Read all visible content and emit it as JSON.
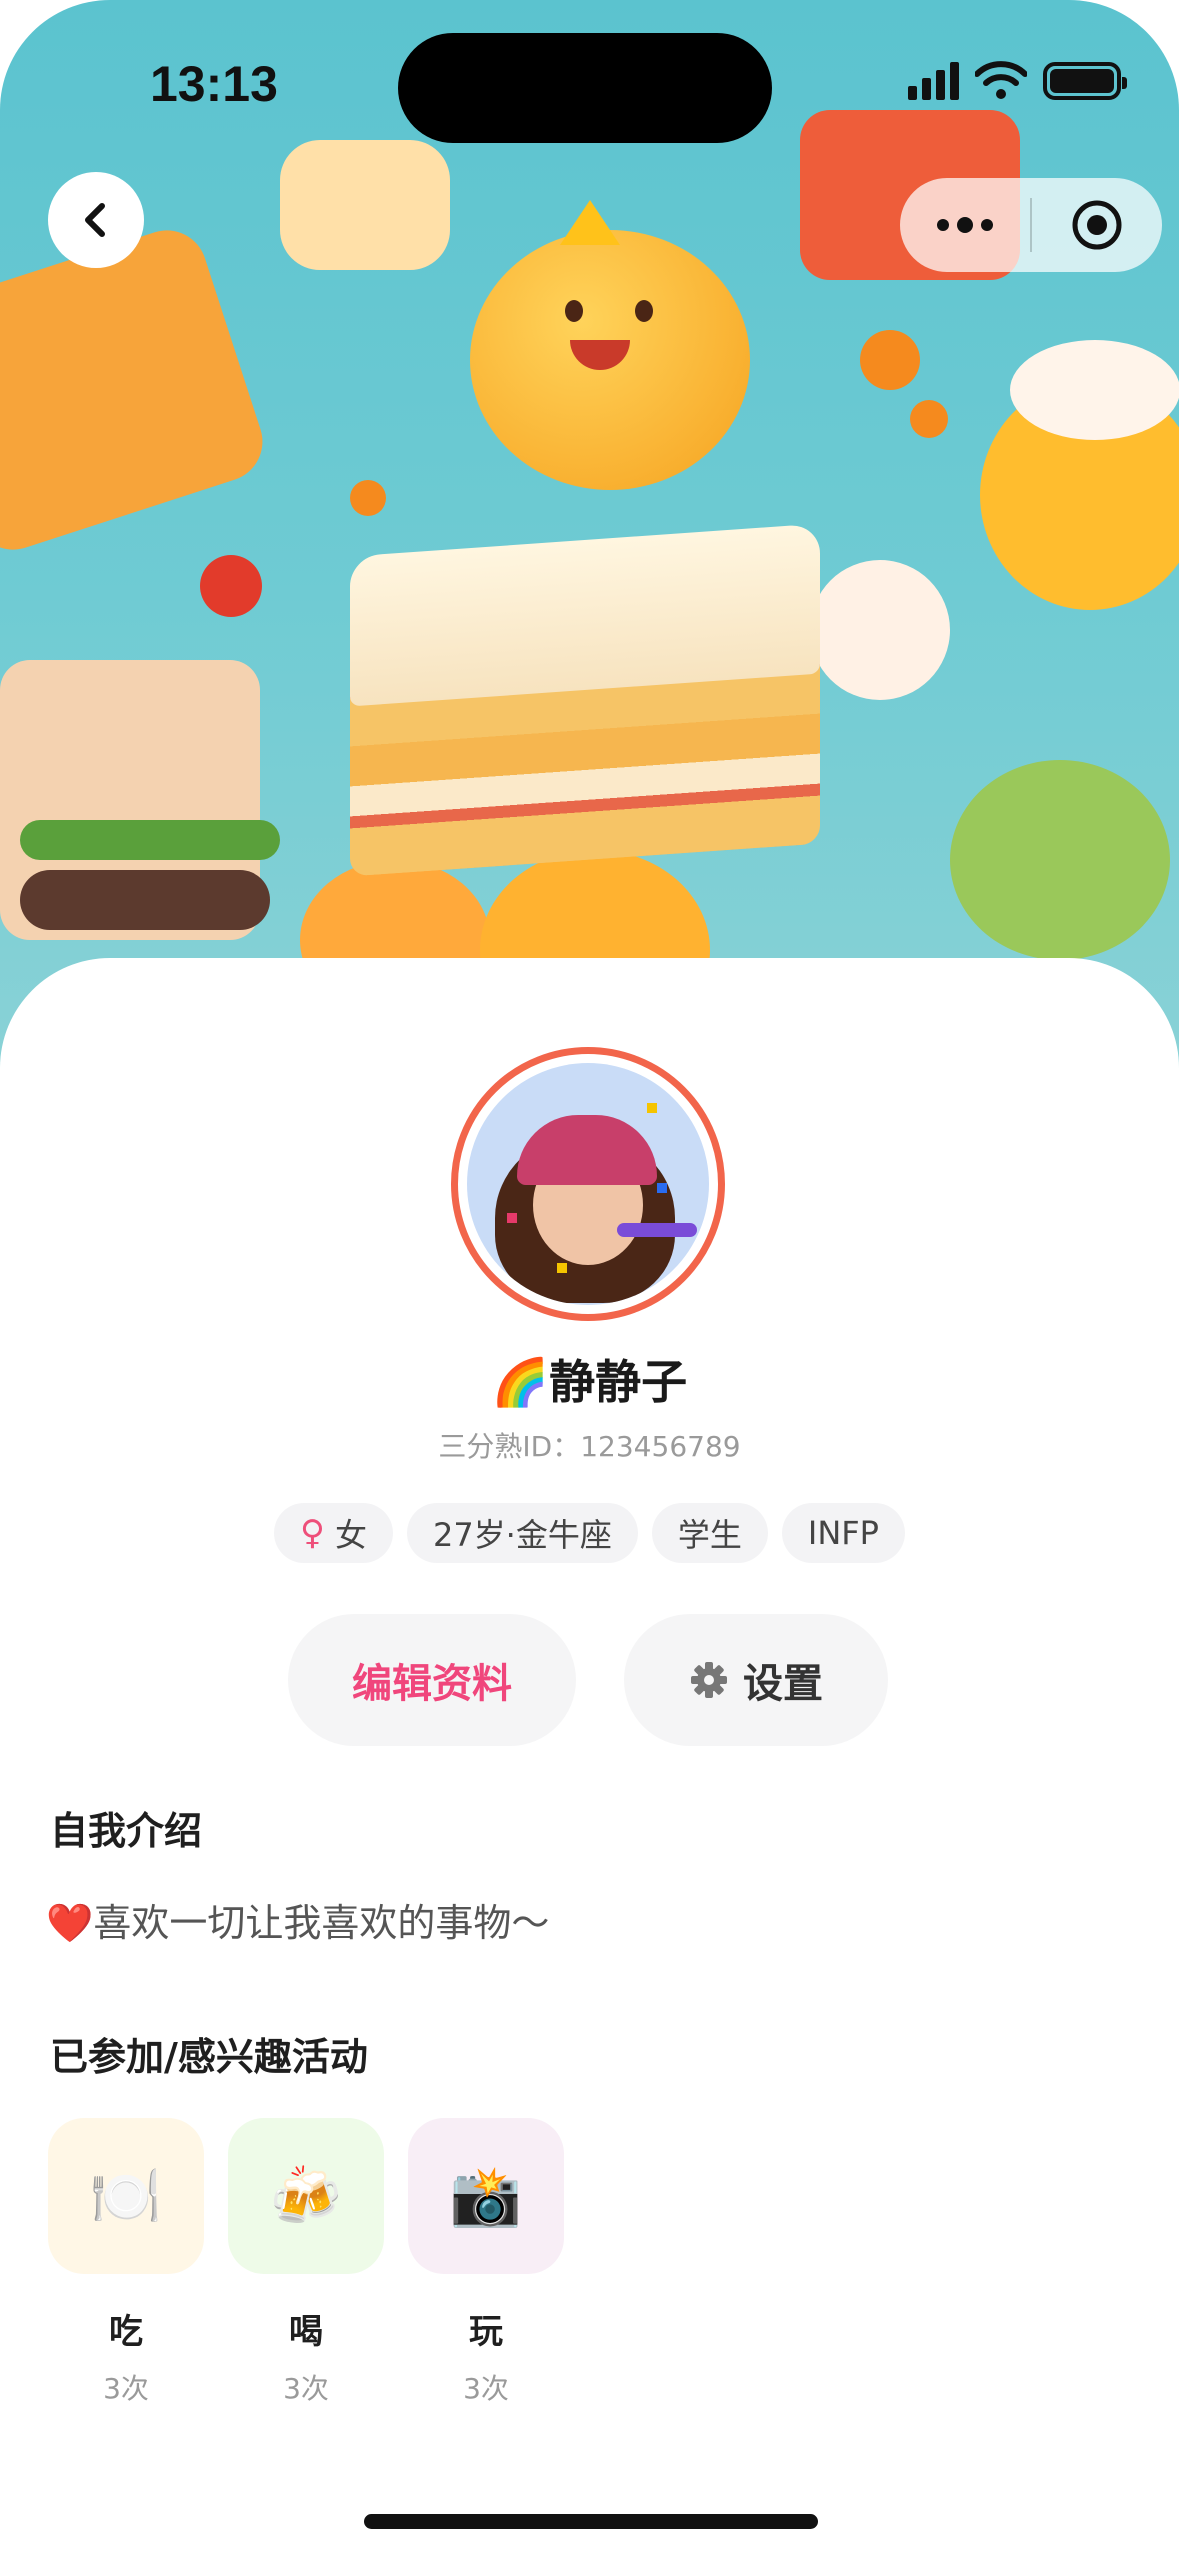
{
  "status_bar": {
    "time": "13:13"
  },
  "profile": {
    "nickname": "🌈静静子",
    "uid": "三分熟ID：123456789",
    "tags": [
      {
        "icon": "♀",
        "label": "女"
      },
      {
        "label": "27岁·金牛座"
      },
      {
        "label": "学生"
      },
      {
        "label": "INFP"
      }
    ]
  },
  "actions": {
    "edit_label": "编辑资料",
    "settings_label": "设置"
  },
  "intro": {
    "title": "自我介绍",
    "text": "❤️喜欢一切让我喜欢的事物～"
  },
  "activities": {
    "title": "已参加/感兴趣活动",
    "items": [
      {
        "icon": "🍽️",
        "name": "吃",
        "count": "3次",
        "bg": "#fff7e6"
      },
      {
        "icon": "🍻",
        "name": "喝",
        "count": "3次",
        "bg": "#eefbe8"
      },
      {
        "icon": "📸",
        "name": "玩",
        "count": "3次",
        "bg": "#f8eef6"
      }
    ]
  },
  "colors": {
    "accent_pink": "#f0467c",
    "avatar_ring": "#f2654b",
    "banner_bg": "#5bc3cf"
  }
}
